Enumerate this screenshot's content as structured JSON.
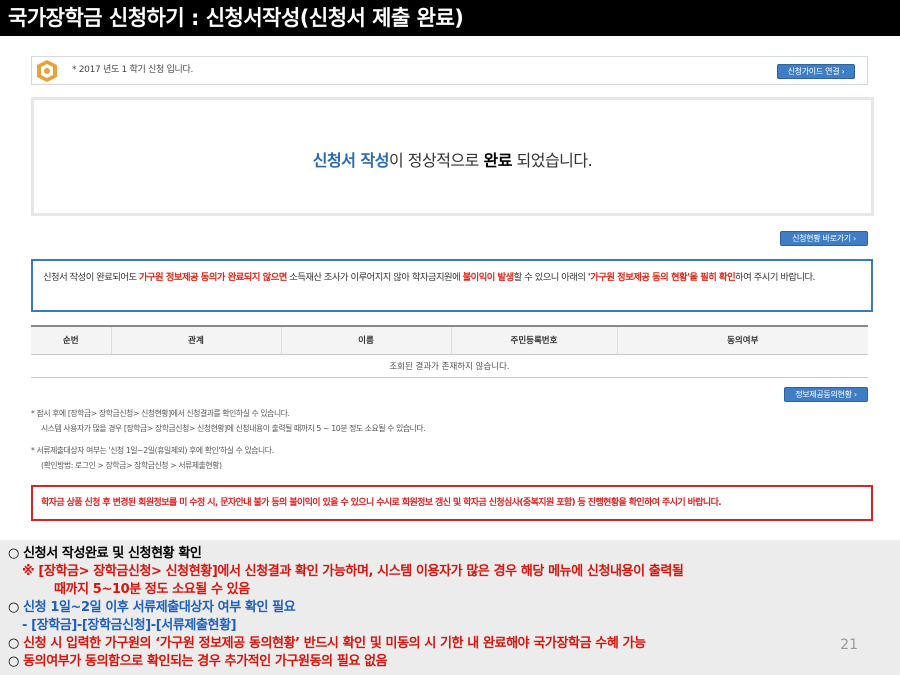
{
  "title": "국가장학금 신청하기 : 신청서작성(신청서 제출 완료)",
  "notice": {
    "text": "* 2017 년도 1 학기 신청 입니다.",
    "guide_button": "신청가이드 연결 ›"
  },
  "completion": {
    "part1": "신청서 작성",
    "part2": "이 정상적으로 ",
    "part3": "완료",
    "part4": " 되었습니다."
  },
  "status_button": "신청현황 바로가기 ›",
  "warning": {
    "t1": "신청서 작성이 완료되어도 ",
    "r1": "가구원 정보제공 동의가 완료되지 않으면",
    "t2": " 소득재산 조사가 이루어지지 않아 학자금지원에 ",
    "r2": "불이익이 발생",
    "t3": "할 수 있으니 아래의 ",
    "r3": "'가구원 정보제공 동의 현황'을 필히 확인",
    "t4": "하여 주시기 바랍니다."
  },
  "table": {
    "headers": [
      "순번",
      "관계",
      "이름",
      "주민등록번호",
      "동의여부"
    ],
    "empty": "조회된 결과가 존재하지 않습니다."
  },
  "consent_button": "정보제공동의현황 ›",
  "guide": {
    "l1": "* 잠시 후에 [장학금> 장학금신청> 신청현황]에서 신청결과를 확인하실 수 있습니다.",
    "l2": "시스템 사용자가 많을 경우 [장학금> 장학금신청> 신청현황]에 신청내용이 출력될 때까지 5 ~ 10분 정도 소요될 수 있습니다.",
    "l3": "* 서류제출대상자 여부는 '신청 1일~2일(휴일제외) 후에 확인'하실 수 있습니다.",
    "l4": "(확인방법: 로그인 > 장학금> 장학금신청 > 서류제출현황)"
  },
  "alert": "학자금 상품 신청 후 변경된 회원정보를 미 수정 시, 문자안내 불가 등의 불이익이 있을 수 있으니 수시로 회원정보 갱신 및 학자금 신청심사(중복지원 포함) 등 진행현황을 확인하여 주시기 바랍니다.",
  "notes": {
    "bullet": "○",
    "n1": "신청서 작성완료 및 신청현황 확인",
    "n2": "※ [장학금> 장학금신청> 신청현황]에서 신청결과 확인 가능하며, 시스템 이용자가 많은 경우 해당 메뉴에 신청내용이 출력될",
    "n3": "때까지 5~10분 정도 소요될 수 있음",
    "n4": "신청 1일~2일 이후 서류제출대상자 여부 확인 필요",
    "n5": "- [장학금]-[장학금신청]-[서류제출현황]",
    "n6": "신청 시 입력한 가구원의 ‘가구원 정보제공 동의현황’ 반드시 확인 및 미동의 시 기한 내 완료해야 국가장학금 수혜 가능",
    "n7": "동의여부가 동의함으로 확인되는 경우 추가적인 가구원동의 필요 없음"
  },
  "page_number": "21"
}
